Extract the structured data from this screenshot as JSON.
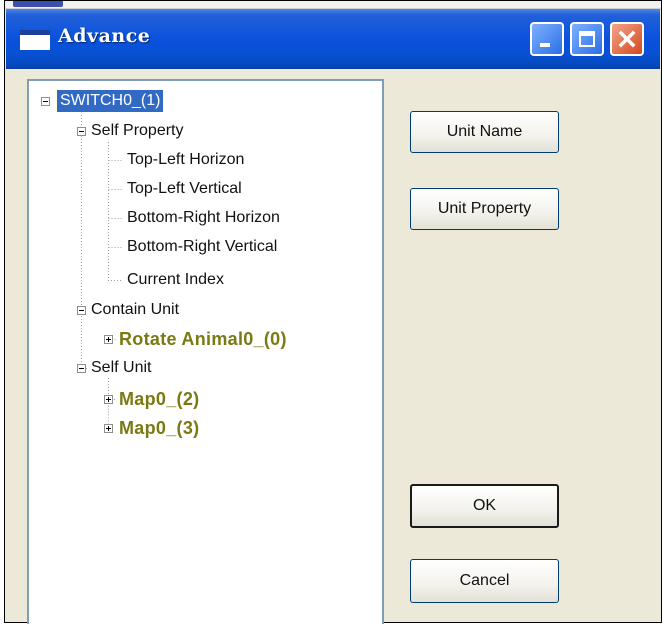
{
  "window": {
    "title": "Advance"
  },
  "titlebar_buttons": {
    "minimize": "minimize-icon",
    "maximize": "maximize-icon",
    "close": "close-icon"
  },
  "tree": {
    "root": "SWITCH0_(1)",
    "self_property": {
      "label": "Self Property",
      "items": [
        "Top-Left Horizon",
        "Top-Left Vertical",
        "Bottom-Right Horizon",
        "Bottom-Right Vertical",
        "Current Index"
      ]
    },
    "contain_unit": {
      "label": "Contain Unit",
      "items": [
        "Rotate Animal0_(0)"
      ]
    },
    "self_unit": {
      "label": "Self Unit",
      "items": [
        "Map0_(2)",
        "Map0_(3)"
      ]
    }
  },
  "buttons": {
    "unit_name": "Unit Name",
    "unit_property": "Unit Property",
    "ok": "OK",
    "cancel": "Cancel"
  },
  "colors": {
    "titlebar": "#0a52dd",
    "selection": "#316ac5",
    "unit_text": "#7a7a12",
    "dialog_bg": "#ece9d8"
  }
}
